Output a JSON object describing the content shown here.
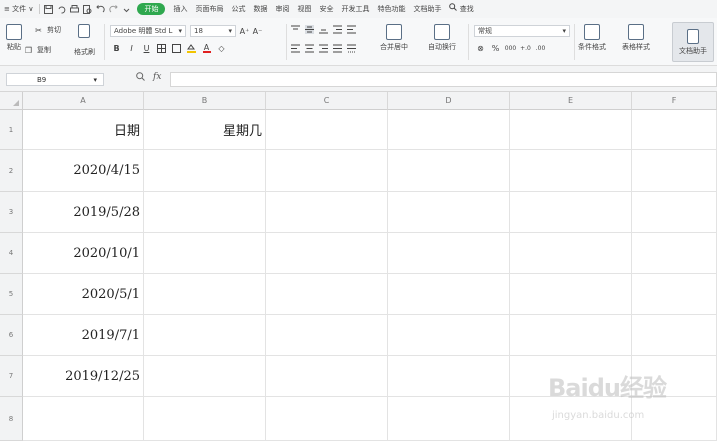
{
  "menubar": {
    "menu_icon": "≡",
    "file_label": "文件",
    "file_arrow": "∨",
    "quick_icons": [
      "save-icon",
      "undo-history-icon",
      "print-icon",
      "print-preview-icon",
      "undo-icon",
      "redo-icon",
      "customize-icon"
    ],
    "tabs": [
      "开始",
      "插入",
      "页面布局",
      "公式",
      "数据",
      "审阅",
      "视图",
      "安全",
      "开发工具",
      "特色功能",
      "文档助手"
    ],
    "active_tab_index": 0,
    "search_label": "查找"
  },
  "ribbon": {
    "paste_label": "粘贴",
    "cut_label": "剪切",
    "copy_label": "复制",
    "format_painter_label": "格式刷",
    "font_name": "Adobe 明體 Std L",
    "font_size": "18",
    "font_grow": "A⁺",
    "font_shrink": "A⁻",
    "bold": "B",
    "italic": "I",
    "underline": "U",
    "font_color_label": "A",
    "merge_center_label": "合并居中",
    "wrap_text_label": "自动换行",
    "number_format": "常规",
    "percent": "%",
    "thousands": "000",
    "cond_format_label": "条件格式",
    "table_style_label": "表格样式",
    "doc_helper_label": "文档助手"
  },
  "formula_bar": {
    "name_box": "B9",
    "fx_label": "fx",
    "zoom_icon": "zoom-icon",
    "formula": ""
  },
  "grid": {
    "columns": [
      "A",
      "B",
      "C",
      "D",
      "E",
      "F"
    ],
    "rows": [
      "1",
      "2",
      "3",
      "4",
      "5",
      "6",
      "7",
      "8"
    ],
    "header_row": {
      "a": "日期",
      "b": "星期几"
    },
    "dates": [
      "2020/4/15",
      "2019/5/28",
      "2020/10/1",
      "2020/5/1",
      "2019/7/1",
      "2019/12/25"
    ]
  },
  "watermark": {
    "logo": "Baidu经验",
    "sub": "jingyan.baidu.com"
  }
}
